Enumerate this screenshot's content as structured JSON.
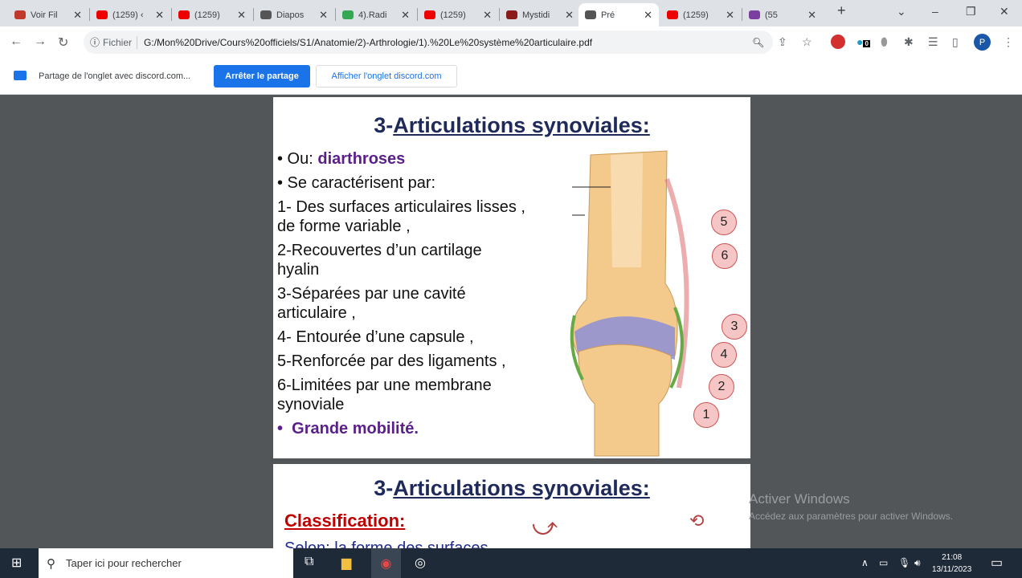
{
  "tabs": [
    {
      "label": "Voir Fil",
      "color": "#c0392b"
    },
    {
      "label": "(1259) ‹",
      "color": "#e00"
    },
    {
      "label": "(1259)",
      "color": "#e00"
    },
    {
      "label": "Diapos",
      "color": "#555"
    },
    {
      "label": "4).Radi",
      "color": "#34a853"
    },
    {
      "label": "(1259)",
      "color": "#e00"
    },
    {
      "label": "Mystidi",
      "color": "#8b1a1a"
    },
    {
      "label": "Pré",
      "color": "#555",
      "active": true
    },
    {
      "label": "(1259)",
      "color": "#e00"
    },
    {
      "label": "(55",
      "color": "#7b3fa0"
    }
  ],
  "address": {
    "scheme_label": "Fichier",
    "url": "G:/Mon%20Drive/Cours%20officiels/S1/Anatomie/2)-Arthrologie/1).%20Le%20système%20articulaire.pdf",
    "profile": "P",
    "ext_badge": "0"
  },
  "share": {
    "text": "Partage de l'onglet avec discord.com...",
    "stop": "Arrêter le partage",
    "show": "Afficher l'onglet discord.com"
  },
  "slide1": {
    "title_prefix": "3-",
    "title": "Articulations synoviales:",
    "l1a": "• Ou: ",
    "l1b": "diarthroses",
    "l2": "• Se caractérisent par:",
    "l3": "1- Des surfaces articulaires lisses ,",
    "l3b": "de forme variable ,",
    "l4": "2-Recouvertes d’un cartilage",
    "l4b": "hyalin",
    "l5": "3-Séparées par une cavité",
    "l5b": "articulaire ,",
    "l6": "4- Entourée d’une capsule ,",
    "l7": "5-Renforcée par des ligaments ,",
    "l8": "6-Limitées par une membrane",
    "l8b": "synoviale",
    "l9a": "•",
    "l9b": "Grande mobilité.",
    "labels": [
      "5",
      "6",
      "3",
      "4",
      "2",
      "1"
    ]
  },
  "slide2": {
    "title_prefix": "3-",
    "title": "Articulations synoviales:",
    "classification": "Classification:",
    "partial": "Selon: la forme des surfaces"
  },
  "watermark": {
    "line1": "Activer Windows",
    "line2": "Accédez aux paramètres pour activer Windows."
  },
  "taskbar": {
    "search": "Taper ici pour rechercher",
    "time": "21:08",
    "date": "13/11/2023"
  }
}
